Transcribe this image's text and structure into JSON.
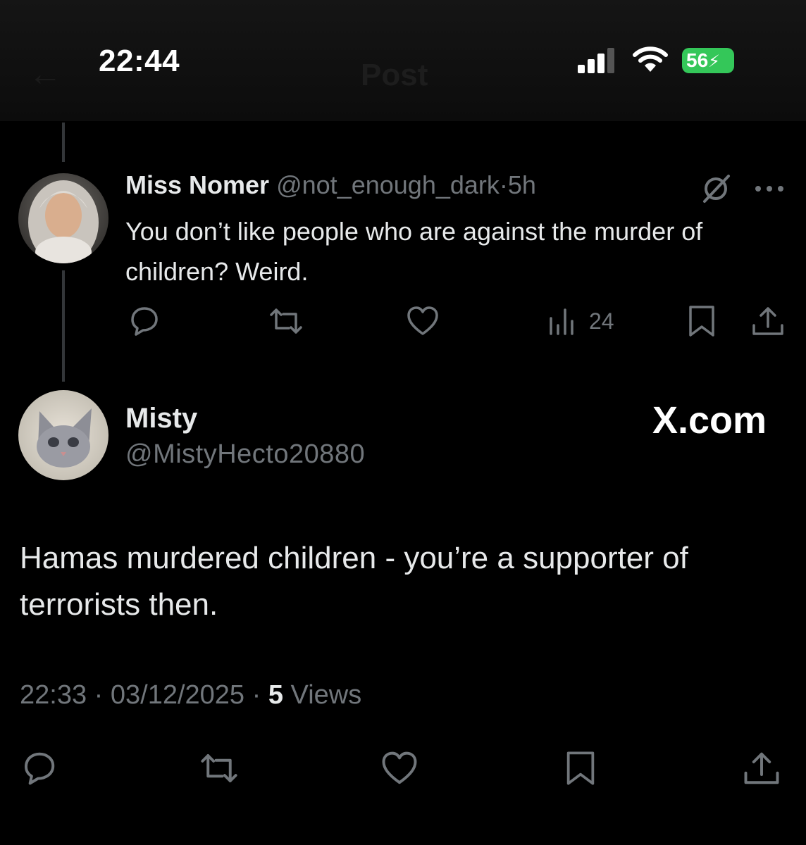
{
  "status_bar": {
    "time": "22:44",
    "battery": "56",
    "colors": {
      "battery": "#34c759"
    }
  },
  "header": {
    "title": "Post",
    "back_icon": "arrow-left-icon"
  },
  "reply_tweet": {
    "display_name": "Miss Nomer",
    "handle": "@not_enough_dark",
    "separator": "·",
    "age": "5h",
    "text": "You don’t like people who are against the murder of children? Weird.",
    "views": "24",
    "icons": [
      "reply-icon",
      "retweet-icon",
      "like-icon",
      "views-icon",
      "bookmark-icon",
      "share-icon",
      "grok-icon",
      "more-icon"
    ]
  },
  "main_tweet": {
    "display_name": "Misty",
    "handle": "@MistyHecto20880",
    "text": "Hamas murdered children - you’re a supporter of terrorists then.",
    "time": "22:33",
    "date": "03/12/2025",
    "separator": "·",
    "views_count": "5",
    "views_label": "Views",
    "icons": [
      "reply-icon",
      "retweet-icon",
      "like-icon",
      "bookmark-icon",
      "share-icon"
    ]
  },
  "watermark": "X.com",
  "colors": {
    "background": "#000000",
    "text": "#e7e9ea",
    "muted": "#71767b",
    "thread_line": "#333639"
  }
}
